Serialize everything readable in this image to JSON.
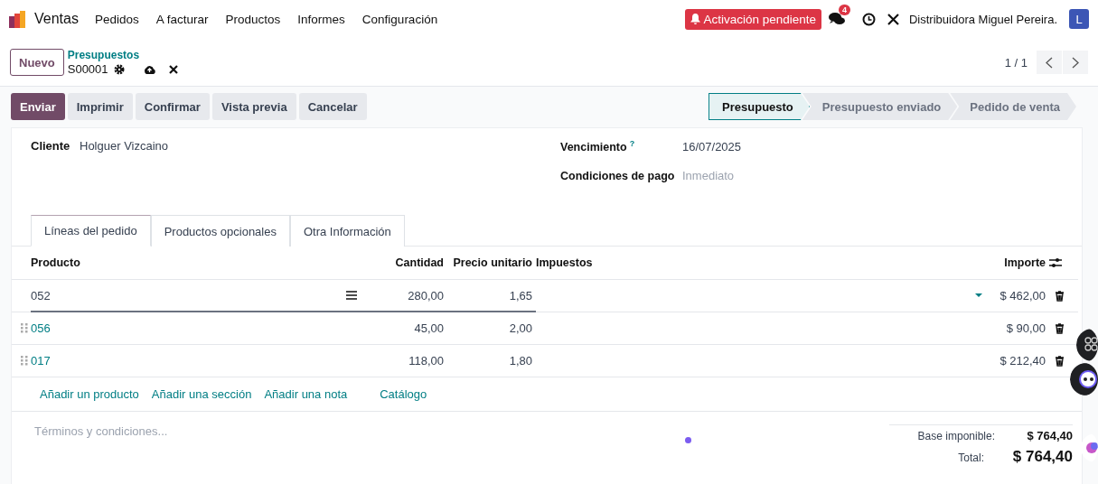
{
  "navbar": {
    "app": "Ventas",
    "menu": [
      "Pedidos",
      "A facturar",
      "Productos",
      "Informes",
      "Configuración"
    ],
    "activation": "Activación pendiente",
    "messages_count": "4",
    "company": "Distribuidora Miguel Pereira.",
    "avatar": "L"
  },
  "control_panel": {
    "new_button": "Nuevo",
    "breadcrumb": "Presupuestos",
    "record": "S00001",
    "pager": "1 / 1"
  },
  "actions": [
    {
      "label": "Enviar",
      "primary": true
    },
    {
      "label": "Imprimir",
      "primary": false
    },
    {
      "label": "Confirmar",
      "primary": false
    },
    {
      "label": "Vista previa",
      "primary": false
    },
    {
      "label": "Cancelar",
      "primary": false
    }
  ],
  "status_steps": [
    {
      "label": "Presupuesto",
      "selected": true
    },
    {
      "label": "Presupuesto enviado",
      "selected": false
    },
    {
      "label": "Pedido de venta",
      "selected": false
    }
  ],
  "form": {
    "customer": {
      "label": "Cliente",
      "value": "Holguer Vizcaino"
    },
    "right_fields": [
      {
        "label": "Vencimiento",
        "help": "?",
        "value": "16/07/2025"
      },
      {
        "label": "Condiciones de pago",
        "placeholder": "Inmediato"
      }
    ]
  },
  "tabs": [
    {
      "label": "Líneas del pedido",
      "selected": true
    },
    {
      "label": "Productos opcionales",
      "selected": false
    },
    {
      "label": "Otra Información",
      "selected": false
    }
  ],
  "table": {
    "columns": [
      "Producto",
      "Cantidad",
      "Precio unitario",
      "Impuestos",
      "Importe"
    ],
    "rows": [
      {
        "product": "052",
        "quantity": "280,00",
        "price": "1,65",
        "amount": "$ 462,00",
        "editing": true
      },
      {
        "product": "056",
        "quantity": "45,00",
        "price": "2,00",
        "amount": "$ 90,00",
        "editing": false
      },
      {
        "product": "017",
        "quantity": "118,00",
        "price": "1,80",
        "amount": "$ 212,40",
        "editing": false
      }
    ],
    "add_links": [
      "Añadir un producto",
      "Añadir una sección",
      "Añadir una nota",
      "Catálogo"
    ]
  },
  "terms": {
    "placeholder": "Términos y condiciones..."
  },
  "totals": [
    {
      "label": "Base imponible:",
      "value": "$ 764,40",
      "kind": "subtotal"
    },
    {
      "label": "Total:",
      "value": "$ 764,40",
      "kind": "total"
    }
  ]
}
